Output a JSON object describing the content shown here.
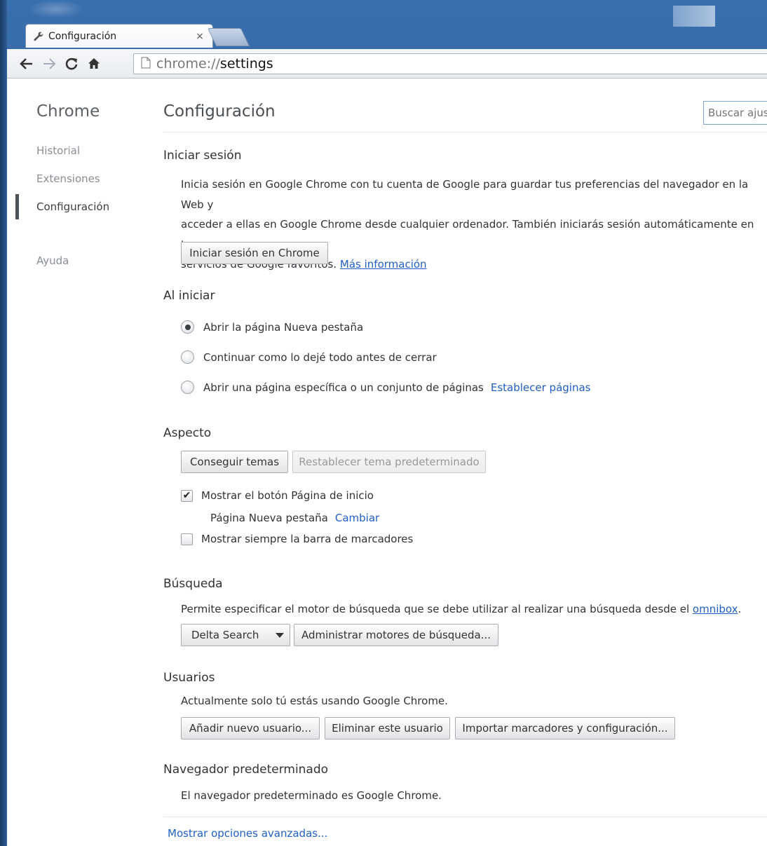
{
  "browser": {
    "tab_title": "Configuración",
    "tab_close": "×",
    "url_scheme": "chrome://",
    "url_host": "settings"
  },
  "nav": {
    "title": "Chrome",
    "items": [
      "Historial",
      "Extensiones",
      "Configuración",
      "Ayuda"
    ],
    "active": "Configuración"
  },
  "main": {
    "title": "Configuración",
    "search_placeholder": "Buscar ajustes"
  },
  "signin": {
    "title": "Iniciar sesión",
    "line1": "Inicia sesión en Google Chrome con tu cuenta de Google para guardar tus preferencias del navegador en la Web y",
    "line2": "acceder a ellas en Google Chrome desde cualquier ordenador. También iniciarás sesión automáticamente en tus",
    "line3": "servicios de Google favoritos.",
    "more_link": "Más información",
    "button": "Iniciar sesión en Chrome"
  },
  "startup": {
    "title": "Al iniciar",
    "options": [
      "Abrir la página Nueva pestaña",
      "Continuar como lo dejé todo antes de cerrar",
      "Abrir una página específica o un conjunto de páginas"
    ],
    "selected_index": 0,
    "set_pages_link": "Establecer páginas"
  },
  "appearance": {
    "title": "Aspecto",
    "get_themes": "Conseguir temas",
    "reset_theme": "Restablecer tema predeterminado",
    "show_home": "Mostrar el botón Página de inicio",
    "show_home_checked": true,
    "home_page": "Página Nueva pestaña",
    "change_link": "Cambiar",
    "show_bookmarks": "Mostrar siempre la barra de marcadores",
    "show_bookmarks_checked": false,
    "checkmark": "✔"
  },
  "search": {
    "title": "Búsqueda",
    "desc": "Permite especificar el motor de búsqueda que se debe utilizar al realizar una búsqueda desde el",
    "omnibox_link": "omnibox",
    "period": ".",
    "engine": "Delta Search",
    "manage_button": "Administrar motores de búsqueda..."
  },
  "users": {
    "title": "Usuarios",
    "desc": "Actualmente solo tú estás usando Google Chrome.",
    "add_button": "Añadir nuevo usuario...",
    "remove_button": "Eliminar este usuario",
    "import_button": "Importar marcadores y configuración..."
  },
  "default_browser": {
    "title": "Navegador predeterminado",
    "desc": "El navegador predeterminado es Google Chrome."
  },
  "advanced_link": "Mostrar opciones avanzadas..."
}
